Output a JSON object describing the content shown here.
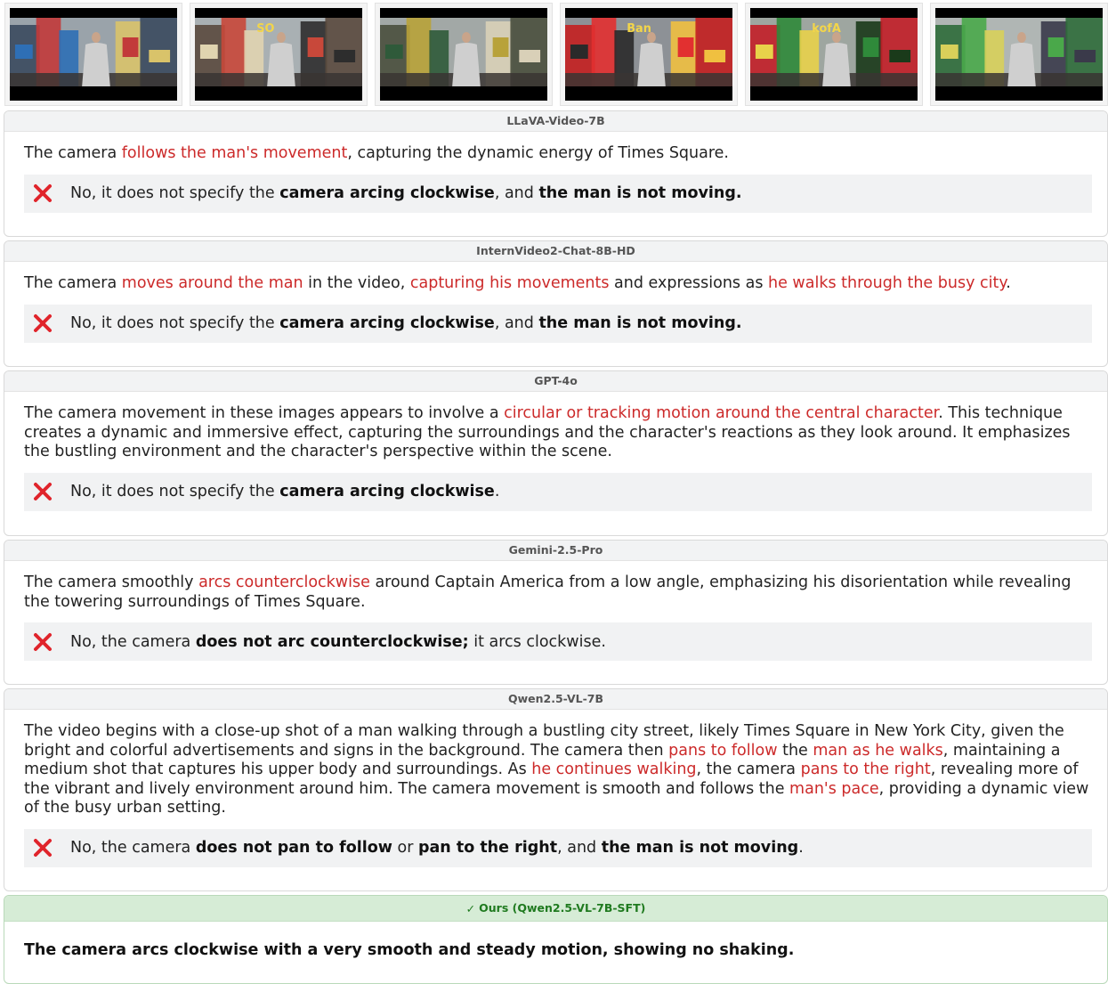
{
  "frames": [
    {
      "label": "frame-1",
      "sign": ""
    },
    {
      "label": "frame-2",
      "sign": "SO"
    },
    {
      "label": "frame-3",
      "sign": ""
    },
    {
      "label": "frame-4",
      "sign": "Ban"
    },
    {
      "label": "frame-5",
      "sign": "kofA"
    },
    {
      "label": "frame-6",
      "sign": ""
    }
  ],
  "panels": [
    {
      "model": "LLaVA-Video-7B",
      "answer": [
        {
          "t": "The camera "
        },
        {
          "t": "follows the man's movement",
          "hl": true
        },
        {
          "t": ", capturing the dynamic energy of Times Square."
        }
      ],
      "verdict": [
        {
          "t": "No, it does not specify the "
        },
        {
          "t": "camera arcing clockwise",
          "b": true
        },
        {
          "t": ", and "
        },
        {
          "t": "the man is not moving.",
          "b": true
        }
      ]
    },
    {
      "model": "InternVideo2-Chat-8B-HD",
      "answer": [
        {
          "t": "The camera "
        },
        {
          "t": "moves around the man",
          "hl": true
        },
        {
          "t": " in the video, "
        },
        {
          "t": "capturing his movements",
          "hl": true
        },
        {
          "t": " and expressions as "
        },
        {
          "t": "he walks through the busy city",
          "hl": true
        },
        {
          "t": "."
        }
      ],
      "verdict": [
        {
          "t": "No, it does not specify the "
        },
        {
          "t": "camera arcing clockwise",
          "b": true
        },
        {
          "t": ", and "
        },
        {
          "t": "the man is not moving.",
          "b": true
        }
      ]
    },
    {
      "model": "GPT-4o",
      "answer": [
        {
          "t": "The camera movement in these images appears to involve a "
        },
        {
          "t": "circular or tracking motion around the central character",
          "hl": true
        },
        {
          "t": ". This technique creates a dynamic and immersive effect, capturing the surroundings and the character's reactions as they look around. It emphasizes the bustling environment and the character's perspective within the scene."
        }
      ],
      "verdict": [
        {
          "t": "No, it does not specify the "
        },
        {
          "t": "camera arcing clockwise",
          "b": true
        },
        {
          "t": "."
        }
      ]
    },
    {
      "model": "Gemini-2.5-Pro",
      "answer": [
        {
          "t": "The camera smoothly "
        },
        {
          "t": "arcs counterclockwise",
          "hl": true
        },
        {
          "t": " around Captain America from a low angle, emphasizing his disorientation while revealing the towering surroundings of Times Square."
        }
      ],
      "verdict": [
        {
          "t": "No, the camera "
        },
        {
          "t": "does not arc counterclockwise;",
          "b": true
        },
        {
          "t": " it arcs clockwise."
        }
      ]
    },
    {
      "model": "Qwen2.5-VL-7B",
      "answer": [
        {
          "t": "The video begins with a close-up shot of a man walking through a bustling city street, likely Times Square in New York City, given the bright and colorful advertisements and signs in the background. The camera then "
        },
        {
          "t": "pans to follow",
          "hl": true
        },
        {
          "t": " the "
        },
        {
          "t": "man as he walks",
          "hl": true
        },
        {
          "t": ", maintaining a medium shot that captures his upper body and surroundings. As "
        },
        {
          "t": "he continues walking",
          "hl": true
        },
        {
          "t": ", the camera "
        },
        {
          "t": "pans to the right",
          "hl": true
        },
        {
          "t": ", revealing more of the vibrant and lively environment around him. The camera movement is smooth and follows the "
        },
        {
          "t": "man's pace",
          "hl": true
        },
        {
          "t": ", providing a dynamic view of the busy urban setting."
        }
      ],
      "verdict": [
        {
          "t": "No, the camera "
        },
        {
          "t": "does not pan to follow",
          "b": true
        },
        {
          "t": " or "
        },
        {
          "t": "pan to the right",
          "b": true
        },
        {
          "t": ", and "
        },
        {
          "t": "the man is not moving",
          "b": true
        },
        {
          "t": "."
        }
      ]
    }
  ],
  "ours": {
    "check": "✓",
    "model": "Ours (Qwen2.5-VL-7B-SFT)",
    "answer": "The camera arcs clockwise with a very smooth and steady motion, showing no shaking."
  },
  "colors": {
    "highlight": "#cc2a2a",
    "wrong_icon": "#e0242b",
    "ours_header_bg": "#d6ecd6",
    "ours_header_text": "#1f7a1f"
  },
  "icons": {
    "wrong": "x-mark-icon",
    "ours": "check-icon"
  }
}
